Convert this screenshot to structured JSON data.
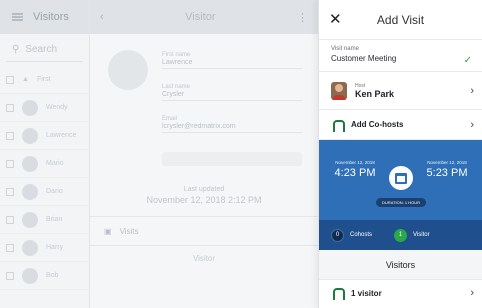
{
  "background": {
    "list_title": "Visitors",
    "search_placeholder": "Search",
    "list_rows": [
      "First",
      "Wendy",
      "Lawrence",
      "Mario",
      "Dario",
      "Brian",
      "Harry",
      "Bob"
    ],
    "detail_title": "Visitor",
    "detail_fields": [
      {
        "label": "First name",
        "value": "Lawrence"
      },
      {
        "label": "Last name",
        "value": "Crysler"
      },
      {
        "label": "Email",
        "value": "lcrysler@redmatrix.com"
      }
    ],
    "last_updated_label": "Last updated",
    "last_updated_value": "November 12, 2018 2:12 PM",
    "visits_label": "Visits",
    "visitor_section": "Visitor"
  },
  "panel": {
    "title": "Add Visit",
    "visit_name_label": "Visit name",
    "visit_name_value": "Customer Meeting",
    "host_label": "Host",
    "host_name": "Ken Park",
    "add_cohosts_label": "Add Co-hosts",
    "start_date": "November 12, 2018",
    "start_time": "4:23 PM",
    "end_date": "November 12, 2018",
    "end_time": "5:23 PM",
    "duration": "DURATION: 1 HOUR",
    "cohosts_count": "0",
    "cohosts_label": "Cohosts",
    "visitor_count": "1",
    "visitor_label": "Visitor",
    "visitors_section_title": "Visitors",
    "visitors_summary": "1 visitor"
  }
}
